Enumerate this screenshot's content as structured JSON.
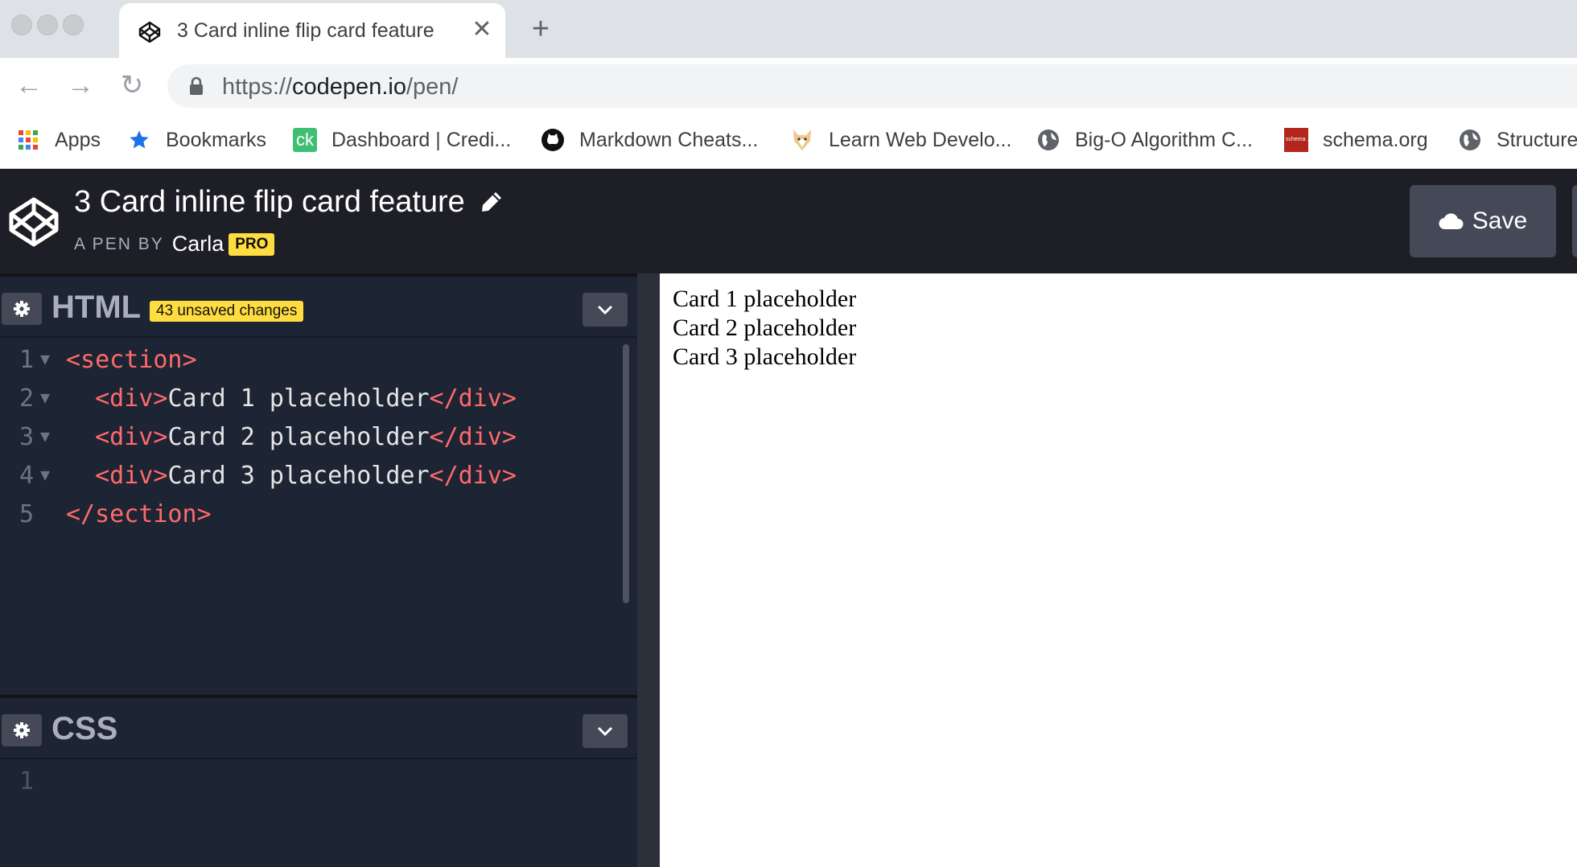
{
  "browser": {
    "tab": {
      "title": "3 Card inline flip card feature",
      "close_glyph": "✕",
      "favicon": "codepen-icon"
    },
    "new_tab_glyph": "+",
    "nav": {
      "back": "←",
      "forward": "→",
      "reload": "↻"
    },
    "url": {
      "prefix": "https://",
      "host": "codepen.io",
      "path": "/pen/"
    },
    "bookmarks": [
      {
        "label": "Apps",
        "icon": "apps-grid-icon"
      },
      {
        "label": "Bookmarks",
        "icon": "star-icon"
      },
      {
        "label": "Dashboard | Credi...",
        "icon": "creditkarma-icon",
        "icon_text": "ck"
      },
      {
        "label": "Markdown Cheats...",
        "icon": "github-icon"
      },
      {
        "label": "Learn Web Develo...",
        "icon": "fox-icon"
      },
      {
        "label": "Big-O Algorithm C...",
        "icon": "globe-icon"
      },
      {
        "label": "schema.org",
        "icon": "schema-icon",
        "icon_text": "schema .org"
      },
      {
        "label": "Structure",
        "icon": "globe-icon"
      }
    ]
  },
  "codepen": {
    "pen_title": "3 Card inline flip card feature",
    "pen_by_label": "A PEN BY",
    "author": "Carla",
    "pro_badge": "PRO",
    "save_label": "Save"
  },
  "editors": {
    "html": {
      "name": "HTML",
      "unsaved_badge": "43 unsaved changes",
      "lines": [
        {
          "n": "1",
          "indent": "",
          "open": "<section>",
          "text": "",
          "close": ""
        },
        {
          "n": "2",
          "indent": "  ",
          "open": "<div>",
          "text": "Card 1 placeholder",
          "close": "</div>"
        },
        {
          "n": "3",
          "indent": "  ",
          "open": "<div>",
          "text": "Card 2 placeholder",
          "close": "</div>"
        },
        {
          "n": "4",
          "indent": "  ",
          "open": "<div>",
          "text": "Card 3 placeholder",
          "close": "</div>"
        },
        {
          "n": "5",
          "indent": "",
          "open": "</section>",
          "text": "",
          "close": ""
        }
      ]
    },
    "css": {
      "name": "CSS",
      "lines": [
        {
          "n": "1"
        }
      ]
    }
  },
  "preview": {
    "lines": [
      "Card 1 placeholder",
      "Card 2 placeholder",
      "Card 3 placeholder"
    ]
  },
  "colors": {
    "header_bg": "#1e1f26",
    "editor_bg": "#1d2433",
    "tag": "#ff6a6a",
    "badge": "#ffdd40"
  }
}
